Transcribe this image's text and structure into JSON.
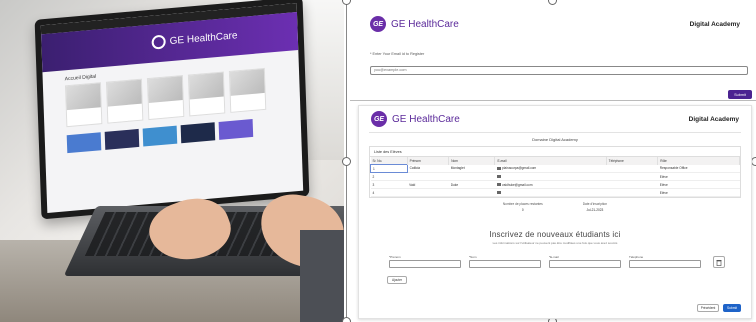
{
  "photo": {
    "screen_brand": "GE HealthCare",
    "section_title": "Accueil Digital"
  },
  "top_form": {
    "brand": "GE HealthCare",
    "header_right": "Digital Academy",
    "email_label": "* Enter Your Email id to Register",
    "email_placeholder": "you@example.com",
    "submit_label": "Submit"
  },
  "bottom_form": {
    "brand": "GE HealthCare",
    "header_right": "Digital Academy",
    "subtitle": "Domaine Digital Academy",
    "list_title": "Liste des Elèves",
    "columns": [
      "Sr. No.",
      "Prénom",
      "Nom",
      "E-mail",
      "Téléphone",
      "Rôle"
    ],
    "rows": [
      [
        "1",
        "Catlicia",
        "Montaglet",
        "plainacurpa@gmail.com",
        "",
        "Responsable Office"
      ],
      [
        "2",
        "",
        "",
        "",
        "",
        "Elève"
      ],
      [
        "3",
        "Vaid",
        "Duke",
        "vaidhuke@gmail.com",
        "",
        "Elève"
      ],
      [
        "4",
        "",
        "",
        "",
        "",
        "Elève"
      ]
    ],
    "meta": [
      {
        "label": "Nombre de places restantes",
        "value": "0"
      },
      {
        "label": "Date d'inscription",
        "value": "Jul-21-2023"
      }
    ],
    "signup_title": "Inscrivez de nouveaux étudiants ici",
    "signup_sub": "Les informations sur l'utilisateur ne peuvent pas être modifiées une fois que vous avez soumis",
    "fields": [
      "*Prénom",
      "*Nom",
      "*E-mail",
      "Téléphone"
    ],
    "add_label": "Ajouter",
    "prev_label": "Précédent",
    "submit_label": "Submit"
  }
}
